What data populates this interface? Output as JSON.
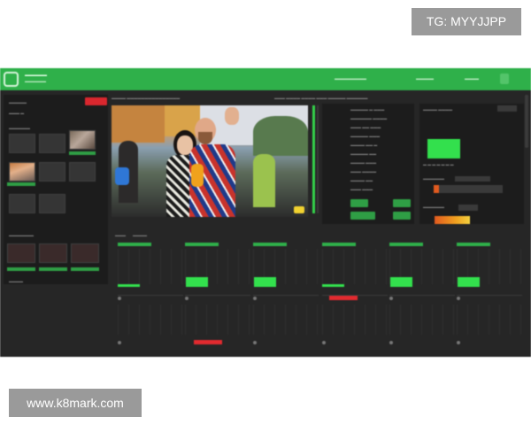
{
  "badges": {
    "tg": "TG: MYYJJPP",
    "url": "www.k8mark.com"
  },
  "colors": {
    "topbar": "#2fb04a",
    "accent_green": "#33e04d",
    "alert_red": "#d9272e",
    "background": "#262626"
  },
  "icons": {
    "logo": "app-logo-icon",
    "toolbar": "toolbar-button-icon"
  }
}
